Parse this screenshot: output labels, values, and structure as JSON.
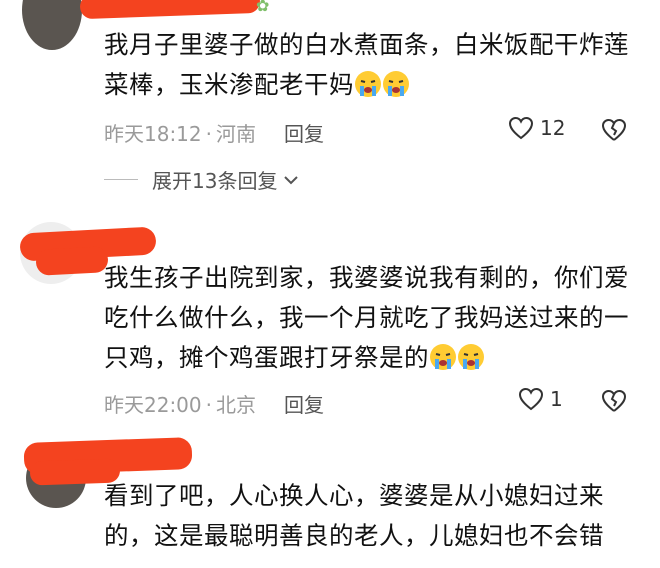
{
  "comments": [
    {
      "text": "我月子里婆子做的白水煮面条，白米饭配干炸莲菜棒，玉米渗配老干妈",
      "emoji_count": 2,
      "time": "昨天18:12",
      "location": "河南",
      "reply_label": "回复",
      "likes": "12"
    },
    {
      "text": "我生孩子出院到家，我婆婆说我有剩的，你们爱吃什么做什么，我一个月就吃了我妈送过来的一只鸡，摊个鸡蛋跟打牙祭是的",
      "emoji_count": 2,
      "time": "昨天22:00",
      "location": "北京",
      "reply_label": "回复",
      "likes": "1"
    },
    {
      "text": "看到了吧，人心换人心，婆婆是从小媳妇过来的，这是最聪明善良的老人，儿媳妇也不会错"
    }
  ],
  "expand_replies_label": "展开13条回复",
  "meta_separator": "·",
  "icons": {
    "like": "heart-outline-icon",
    "dislike": "heart-broken-icon",
    "expand": "chevron-down-icon",
    "emoji": "crying-face-emoji"
  },
  "colors": {
    "redaction": "#f4431f",
    "meta_text": "#9a9a9a",
    "body_text": "#111111"
  }
}
